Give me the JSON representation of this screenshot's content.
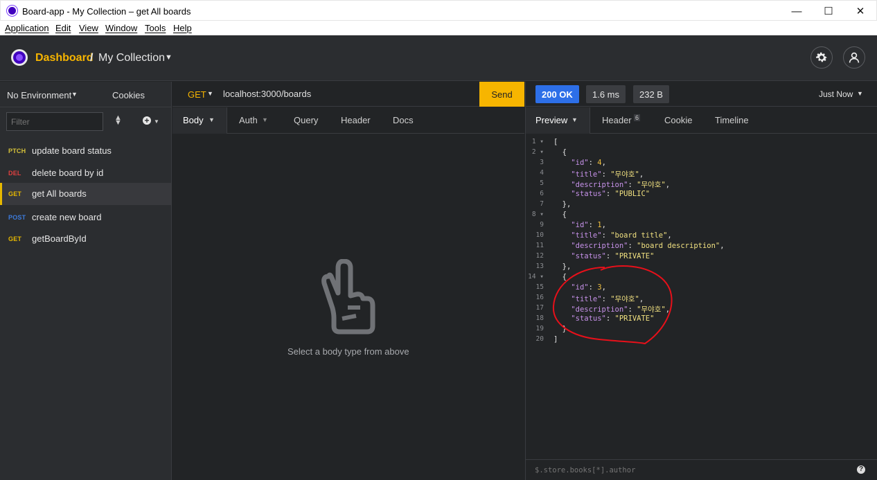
{
  "window": {
    "title": "Board-app - My Collection – get All boards",
    "minimize": "—",
    "maximize": "☐",
    "close": "✕"
  },
  "menu": [
    "Application",
    "Edit",
    "View",
    "Window",
    "Tools",
    "Help"
  ],
  "header": {
    "dashboard": "Dashboard",
    "separator": "/",
    "collection": "My Collection"
  },
  "sidebar": {
    "environment": "No Environment",
    "cookies": "Cookies",
    "filter_placeholder": "Filter",
    "requests": [
      {
        "method": "PTCH",
        "name": "update board status",
        "color": "#d6c23a"
      },
      {
        "method": "DEL",
        "name": "delete board by id",
        "color": "#e0403f"
      },
      {
        "method": "GET",
        "name": "get All boards",
        "color": "#e6b800"
      },
      {
        "method": "POST",
        "name": "create new board",
        "color": "#3c7bdc"
      },
      {
        "method": "GET",
        "name": "getBoardById",
        "color": "#e6b800"
      }
    ]
  },
  "request": {
    "method": "GET",
    "url": "localhost:3000/boards",
    "send": "Send",
    "tabs": [
      "Body",
      "Auth",
      "Query",
      "Header",
      "Docs"
    ],
    "empty_message": "Select a body type from above"
  },
  "response": {
    "status": "200 OK",
    "time": "1.6 ms",
    "size": "232 B",
    "when": "Just Now",
    "tabs": [
      "Preview",
      "Header",
      "Cookie",
      "Timeline"
    ],
    "header_count": "6",
    "filter_placeholder": "$.store.books[*].author",
    "help": "?"
  },
  "response_lines": [
    "[",
    "  {",
    "    \"id\": 4,",
    "    \"title\": \"무야호\",",
    "    \"description\": \"무야호\",",
    "    \"status\": \"PUBLIC\"",
    "  },",
    "  {",
    "    \"id\": 1,",
    "    \"title\": \"board title\",",
    "    \"description\": \"board description\",",
    "    \"status\": \"PRIVATE\"",
    "  },",
    "  {",
    "    \"id\": 3,",
    "    \"title\": \"무야호\",",
    "    \"description\": \"무야호\",",
    "    \"status\": \"PRIVATE\"",
    "  }",
    "]"
  ],
  "colors": {
    "accent": "#f7b500",
    "status_ok": "#2d6fe8",
    "annotation": "#e8101a"
  }
}
